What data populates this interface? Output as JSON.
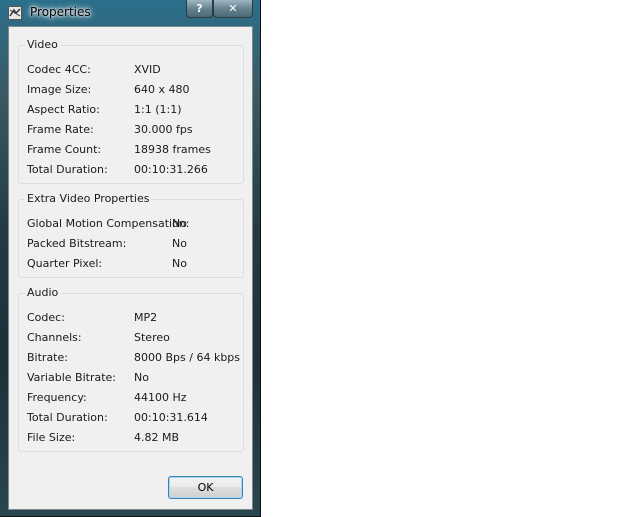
{
  "window": {
    "title": "Properties",
    "help_glyph": "?",
    "close_glyph": "✕"
  },
  "video": {
    "title": "Video",
    "rows": [
      {
        "label": "Codec 4CC:",
        "value": "XVID"
      },
      {
        "label": "Image Size:",
        "value": "640 x 480"
      },
      {
        "label": "Aspect Ratio:",
        "value": "1:1 (1:1)"
      },
      {
        "label": "Frame Rate:",
        "value": "30.000 fps"
      },
      {
        "label": "Frame Count:",
        "value": "18938 frames"
      },
      {
        "label": "Total Duration:",
        "value": "00:10:31.266"
      }
    ]
  },
  "extra": {
    "title": "Extra Video Properties",
    "rows": [
      {
        "label": "Global Motion Compensation:",
        "value": "No"
      },
      {
        "label": "Packed Bitstream:",
        "value": "No"
      },
      {
        "label": "Quarter Pixel:",
        "value": "No"
      }
    ]
  },
  "audio": {
    "title": "Audio",
    "rows": [
      {
        "label": "Codec:",
        "value": "MP2"
      },
      {
        "label": "Channels:",
        "value": "Stereo"
      },
      {
        "label": "Bitrate:",
        "value": "8000 Bps / 64 kbps"
      },
      {
        "label": "Variable Bitrate:",
        "value": "No"
      },
      {
        "label": "Frequency:",
        "value": "44100 Hz"
      },
      {
        "label": "Total Duration:",
        "value": "00:10:31.614"
      },
      {
        "label": "File Size:",
        "value": "4.82 MB"
      }
    ]
  },
  "buttons": {
    "ok_label": "OK"
  }
}
